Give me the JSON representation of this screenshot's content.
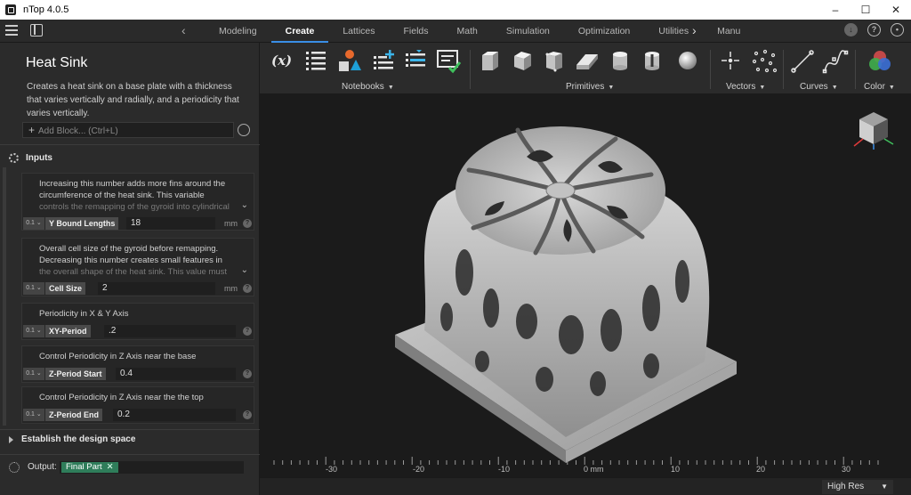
{
  "window": {
    "title": "nTop 4.0.5",
    "controls": [
      "–",
      "☐",
      "✕"
    ]
  },
  "tabs": [
    {
      "label": "Modeling",
      "active": false
    },
    {
      "label": "Create",
      "active": true
    },
    {
      "label": "Lattices",
      "active": false
    },
    {
      "label": "Fields",
      "active": false
    },
    {
      "label": "Math",
      "active": false
    },
    {
      "label": "Simulation",
      "active": false
    },
    {
      "label": "Optimization",
      "active": false
    },
    {
      "label": "Utilities",
      "active": false
    },
    {
      "label": "Manu",
      "active": false
    }
  ],
  "tab_arrows": {
    "left": "‹",
    "right": "›"
  },
  "right_icons": [
    "download-icon",
    "help-icon",
    "account-icon"
  ],
  "notebook": {
    "title": "Heat Sink",
    "description": "Creates a heat sink on a base plate with a thickness that varies vertically and radially, and a periodicity that varies vertically.",
    "add_block_placeholder": "Add Block... (Ctrl+L)",
    "inputs_label": "Inputs",
    "blocks": [
      {
        "description_lines": [
          "Increasing this number adds more fins around the",
          "circumference of the heat sink. This variable"
        ],
        "description_fade": "controls the remapping of the gyroid into cylindrical",
        "type": "0.1",
        "name": "Y Bound Lengths",
        "value": "18",
        "unit": "mm",
        "expandable": true
      },
      {
        "description_lines": [
          "Overall cell size of the gyroid before remapping.",
          "Decreasing this number creates small features in"
        ],
        "description_fade": "the overall shape of the heat sink. This value must",
        "type": "0.1",
        "name": "Cell Size",
        "value": "2",
        "unit": "mm",
        "expandable": true
      },
      {
        "description_lines": [
          "Periodicity in X & Y Axis"
        ],
        "description_fade": "",
        "type": "0.1",
        "name": "XY-Period",
        "value": ".2",
        "unit": "",
        "expandable": false
      },
      {
        "description_lines": [
          "Control Periodicity in Z Axis near the base"
        ],
        "description_fade": "",
        "type": "0.1",
        "name": "Z-Period Start",
        "value": "0.4",
        "unit": "",
        "expandable": false
      },
      {
        "description_lines": [
          "Control Periodicity in Z Axis near the the top"
        ],
        "description_fade": "",
        "type": "0.1",
        "name": "Z-Period End",
        "value": "0.2",
        "unit": "",
        "expandable": false
      }
    ],
    "design_space_label": "Establish the design space",
    "output_label": "Output:",
    "output_value": "Final Part"
  },
  "toolbar": {
    "groups": [
      {
        "label": "Notebooks",
        "tools": [
          "variable-icon",
          "list-icon",
          "shapes-icon",
          "add-list-icon",
          "sort-list-icon",
          "check-notebook-icon"
        ]
      },
      {
        "label": "Primitives",
        "tools": [
          "box-icon",
          "cube-icon",
          "wedge-box-icon",
          "prism-icon",
          "cylinder-icon",
          "hollow-cylinder-icon",
          "sphere-icon"
        ]
      },
      {
        "label": "Vectors",
        "tools": [
          "point-icon",
          "point-cloud-icon"
        ]
      },
      {
        "label": "Curves",
        "tools": [
          "line-icon",
          "spline-icon"
        ]
      },
      {
        "label": "Color",
        "tools": [
          "color-icon"
        ]
      }
    ]
  },
  "ruler": {
    "labels": [
      "-30",
      "-20",
      "-10",
      "0 mm",
      "10",
      "20",
      "30"
    ]
  },
  "status": {
    "resolution": "High Res"
  },
  "colors": {
    "accent": "#3a8ee6",
    "output_chip": "#2f7d5a",
    "panel": "#2b2b2b",
    "viewport": "#1b1b1b"
  }
}
